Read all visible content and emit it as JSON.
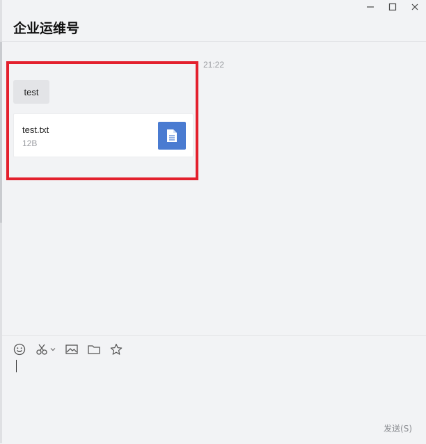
{
  "window": {
    "controls": [
      "minimize-icon",
      "maximize-icon",
      "close-icon"
    ]
  },
  "header": {
    "title": "企业运维号"
  },
  "chat": {
    "timestamp": "21:22",
    "messages": [
      {
        "type": "text",
        "text": "test"
      },
      {
        "type": "file",
        "file_name": "test.txt",
        "file_size": "12B",
        "icon": "document-icon",
        "icon_color": "#4a7bd1"
      }
    ],
    "highlight_color": "#e3202d"
  },
  "compose": {
    "toolbar": [
      "emoji-icon",
      "screenshot-scissors-icon",
      "image-icon",
      "folder-icon",
      "star-icon"
    ],
    "send_label": "发送(S)"
  }
}
